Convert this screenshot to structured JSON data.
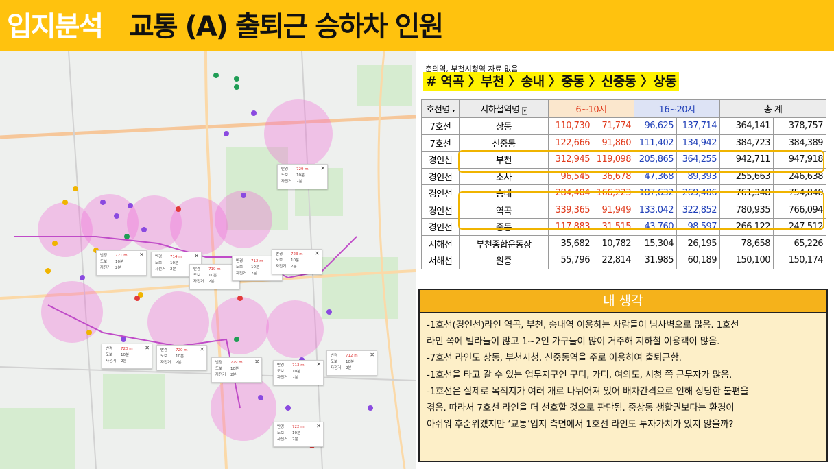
{
  "header": {
    "title_white": "입지분석",
    "title_black": "교통 (A) 출퇴근 승하차 인원"
  },
  "note": "춘의역, 부천시청역 자료 없음",
  "route": "# 역곡 〉부천 〉송내 〉중동 〉신중동 〉상동",
  "table": {
    "headers": {
      "line": "호선명",
      "station": "지하철역명",
      "am": "6~10시",
      "pm": "16~20시",
      "total": "총 계"
    },
    "rows": [
      {
        "line": "7호선",
        "station": "상동",
        "am1": "110,730",
        "am2": "71,774",
        "pm1": "96,625",
        "pm2": "137,714",
        "t1": "364,141",
        "t2": "378,757"
      },
      {
        "line": "7호선",
        "station": "신중동",
        "am1": "122,666",
        "am2": "91,860",
        "pm1": "111,402",
        "pm2": "134,942",
        "t1": "384,723",
        "t2": "384,389"
      },
      {
        "line": "경인선",
        "station": "부천",
        "am1": "312,945",
        "am2": "119,098",
        "pm1": "205,865",
        "pm2": "364,255",
        "t1": "942,711",
        "t2": "947,918"
      },
      {
        "line": "경인선",
        "station": "소사",
        "am1": "96,545",
        "am2": "36,678",
        "pm1": "47,368",
        "pm2": "89,393",
        "t1": "255,663",
        "t2": "246,638"
      },
      {
        "line": "경인선",
        "station": "송내",
        "am1": "284,404",
        "am2": "166,223",
        "pm1": "187,632",
        "pm2": "269,406",
        "t1": "761,348",
        "t2": "754,840"
      },
      {
        "line": "경인선",
        "station": "역곡",
        "am1": "339,365",
        "am2": "91,949",
        "pm1": "133,042",
        "pm2": "322,852",
        "t1": "780,935",
        "t2": "766,094"
      },
      {
        "line": "경인선",
        "station": "중동",
        "am1": "117,883",
        "am2": "31,515",
        "pm1": "43,760",
        "pm2": "98,597",
        "t1": "266,122",
        "t2": "247,512"
      },
      {
        "line": "서해선",
        "station": "부천종합운동장",
        "am1": "35,682",
        "am2": "10,782",
        "pm1": "15,304",
        "pm2": "26,195",
        "t1": "78,658",
        "t2": "65,226"
      },
      {
        "line": "서해선",
        "station": "원종",
        "am1": "55,796",
        "am2": "22,814",
        "pm1": "31,985",
        "pm2": "60,189",
        "t1": "150,100",
        "t2": "150,174"
      }
    ]
  },
  "thoughts": {
    "title": "내 생각",
    "lines": [
      "-1호선(경인선)라인 역곡, 부천, 송내역 이용하는 사람들이 넘사벽으로 많음. 1호선",
      "라인 쪽에 빌라들이 많고 1~2인 가구들이 많이 거주해 지하철 이용객이 많음.",
      "-7호선 라인도 상동, 부천시청, 신중동역을 주로 이용하여 출퇴근함.",
      "-1호선을 타고 갈 수 있는 업무지구인 구디, 가디, 여의도, 시청 쪽 근무자가 많음.",
      "-1호선은 실제로 목적지가 여러 개로 나뉘어져 있어 배차간격으로 인해 상당한 불편을",
      "겪음. 따라서 7호선 라인을 더 선호할 것으로 판단됨. 중상동 생활권보다는 환경이",
      "아쉬워 후순위겠지만 ‘교통’입지 측면에서 1호선 라인도 투자가치가 있지 않을까?"
    ]
  },
  "map": {
    "popup_labels": {
      "walk": "반경",
      "foot": "도보",
      "bike": "자전거"
    },
    "popups": [
      {
        "dist": "729 m",
        "walk": "10분",
        "bike": "2분"
      },
      {
        "dist": "721 m",
        "walk": "10분",
        "bike": "2분"
      },
      {
        "dist": "714 m",
        "walk": "10분",
        "bike": "2분"
      },
      {
        "dist": "719 m",
        "walk": "10분",
        "bike": "2분"
      },
      {
        "dist": "712 m",
        "walk": "10분",
        "bike": "2분"
      },
      {
        "dist": "723 m",
        "walk": "10분",
        "bike": "2분"
      },
      {
        "dist": "720 m",
        "walk": "10분",
        "bike": "2분"
      },
      {
        "dist": "720 m",
        "walk": "10분",
        "bike": "2분"
      },
      {
        "dist": "729 m",
        "walk": "10분",
        "bike": "2분"
      },
      {
        "dist": "713 m",
        "walk": "10분",
        "bike": "2분"
      },
      {
        "dist": "712 m",
        "walk": "10분",
        "bike": "2분"
      },
      {
        "dist": "722 m",
        "walk": "10분",
        "bike": "2분"
      }
    ]
  }
}
